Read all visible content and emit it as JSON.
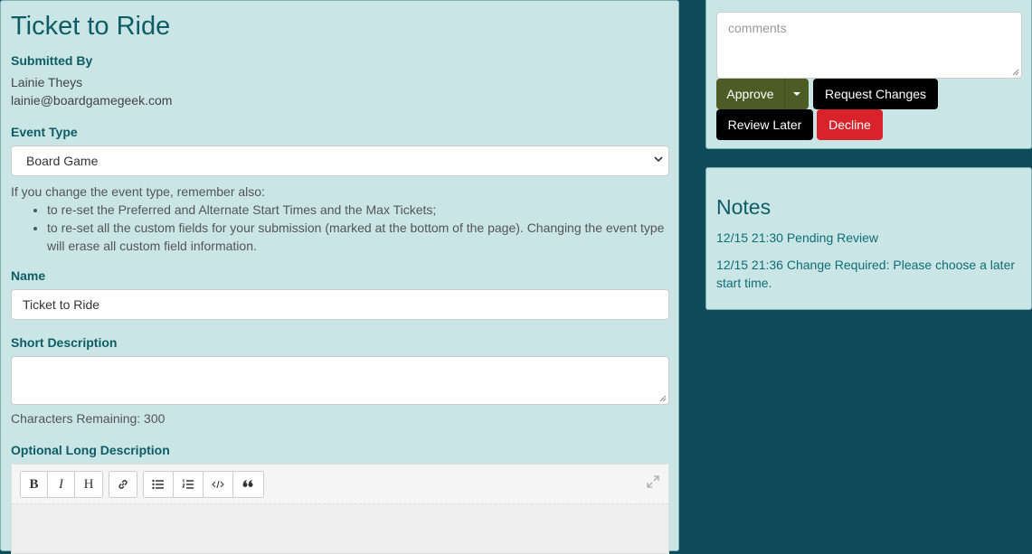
{
  "form": {
    "title": "Ticket to Ride",
    "submitted_by_label": "Submitted By",
    "submitter_name": "Lainie Theys",
    "submitter_email": "lainie@boardgamegeek.com",
    "event_type_label": "Event Type",
    "event_type_value": "Board Game",
    "event_type_hint_intro": "If you change the event type, remember also:",
    "event_type_hints": [
      "to re-set the Preferred and Alternate Start Times and the Max Tickets;",
      "to re-set all the custom fields for your submission (marked at the bottom of the page). Changing the event type will erase all custom field information."
    ],
    "name_label": "Name",
    "name_value": "Ticket to Ride",
    "short_description_label": "Short Description",
    "short_description_value": "",
    "characters_remaining": "Characters Remaining: 300",
    "long_description_label": "Optional Long Description",
    "editor_toolbar": {
      "bold": "B",
      "italic": "I",
      "heading": "H"
    }
  },
  "review": {
    "comments_placeholder": "comments",
    "approve_label": "Approve",
    "request_changes_label": "Request Changes",
    "review_later_label": "Review Later",
    "decline_label": "Decline"
  },
  "notes": {
    "title": "Notes",
    "entries": [
      "12/15 21:30 Pending Review",
      "12/15 21:36 Change Required: Please choose a later start time."
    ]
  },
  "colors": {
    "background": "#0e4a5a",
    "panel": "#cae5e5",
    "accent_text": "#0e5d66",
    "approve": "#4b5d25",
    "decline": "#d9232b"
  }
}
